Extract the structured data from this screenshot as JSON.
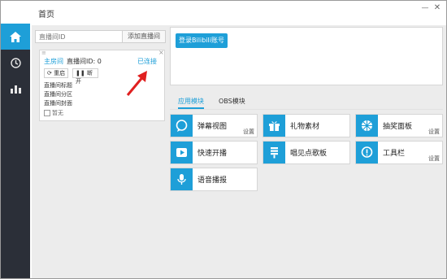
{
  "window": {
    "title": "首页",
    "min_glyph": "—",
    "close_glyph": "✕"
  },
  "sidebar": {
    "items": [
      {
        "name": "home",
        "icon": "home-icon"
      },
      {
        "name": "history",
        "icon": "clock-icon"
      },
      {
        "name": "stats",
        "icon": "bar-chart-icon"
      }
    ]
  },
  "room_input": {
    "placeholder": "直播间ID",
    "add_label": "添加直播间"
  },
  "room_card": {
    "drag_glyph": "≡",
    "close_glyph": "×",
    "main_label": "主房间",
    "id_label": "直播间ID: 0",
    "status": "已连接",
    "reconnect_label": "重启",
    "disconnect_label": "断开",
    "info_title": "直播间标题",
    "info_area": "直播间分区",
    "info_cover": "直播间封面",
    "cover_alt": "暂无"
  },
  "login": {
    "button_label": "登录Bilibili账号"
  },
  "tabs": [
    {
      "label": "应用模块"
    },
    {
      "label": "OBS模块"
    }
  ],
  "modules": [
    {
      "label": "弹幕视图",
      "icon": "chat-bubble-icon",
      "settings": "设置"
    },
    {
      "label": "礼物素材",
      "icon": "gift-icon",
      "settings": ""
    },
    {
      "label": "抽奖面板",
      "icon": "prize-wheel-icon",
      "settings": "设置"
    },
    {
      "label": "快速开播",
      "icon": "play-icon",
      "settings": ""
    },
    {
      "label": "唱见点歌板",
      "icon": "list-icon",
      "settings": ""
    },
    {
      "label": "工具栏",
      "icon": "toolbar-icon",
      "settings": "设置"
    },
    {
      "label": "语音播报",
      "icon": "microphone-icon",
      "settings": ""
    }
  ],
  "colors": {
    "accent": "#1e9fd8",
    "sidebar": "#2b2f38",
    "panel_bg": "#ececec"
  }
}
